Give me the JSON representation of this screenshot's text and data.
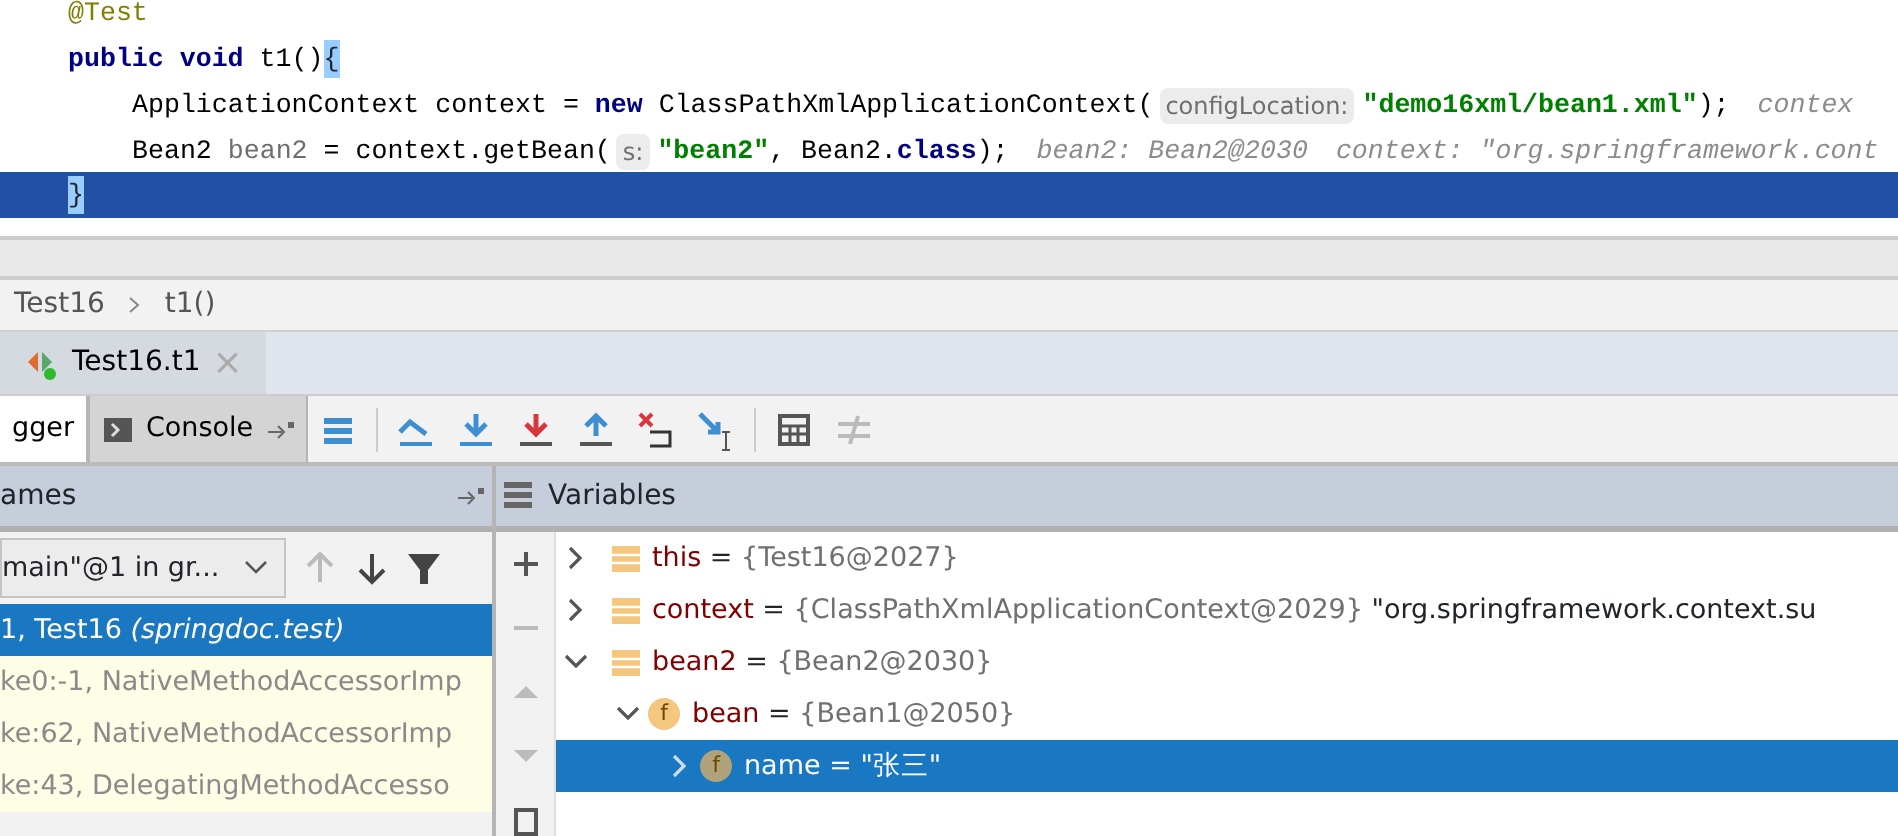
{
  "editor": {
    "lines": [
      {
        "current": false,
        "tokens": [
          {
            "kind": "annotation",
            "text": "@Test"
          }
        ]
      },
      {
        "current": false,
        "tokens": [
          {
            "kind": "keyword",
            "text": "public void"
          },
          {
            "kind": "plain",
            "text": " t1()"
          },
          {
            "kind": "brace",
            "text": "{"
          }
        ],
        "children": [
          {
            "current": false,
            "tokens": [
              {
                "kind": "plain",
                "text": "ApplicationContext context = "
              },
              {
                "kind": "keyword",
                "text": "new"
              },
              {
                "kind": "plain",
                "text": " ClassPathXmlApplicationContext("
              },
              {
                "kind": "param",
                "text": "configLocation:"
              },
              {
                "kind": "string",
                "text": "\"demo16xml/bean1.xml\""
              },
              {
                "kind": "plain",
                "text": ");"
              },
              {
                "kind": "hint",
                "text": "contex"
              }
            ]
          },
          {
            "current": false,
            "tokens": [
              {
                "kind": "plain",
                "text": "Bean2 "
              },
              {
                "kind": "local",
                "text": "bean2"
              },
              {
                "kind": "plain",
                "text": " = context.getBean("
              },
              {
                "kind": "param",
                "text": "s:"
              },
              {
                "kind": "string",
                "text": "\"bean2\""
              },
              {
                "kind": "plain",
                "text": ", Bean2."
              },
              {
                "kind": "keyword",
                "text": "class"
              },
              {
                "kind": "plain",
                "text": ");"
              },
              {
                "kind": "hint",
                "text": "bean2: Bean2@2030"
              },
              {
                "kind": "hint",
                "text": "context: \"org.springframework.cont"
              }
            ]
          }
        ]
      },
      {
        "current": true,
        "tokens": [
          {
            "kind": "brace",
            "text": "}"
          }
        ]
      }
    ]
  },
  "breadcrumb": [
    {
      "text": "Test16"
    },
    {
      "text": "t1()"
    }
  ],
  "run_tab": {
    "label": "Test16.t1",
    "close": "×"
  },
  "debug_tabs": [
    {
      "label": "gger",
      "selected": true
    },
    {
      "label": "Console",
      "selected": false
    }
  ],
  "frames": {
    "title": "ames",
    "thread": "main\"@1 in gr...",
    "rows": [
      {
        "text": "1, Test16",
        "package": "(springdoc.test)",
        "selected": true,
        "kind": "user"
      },
      {
        "text": "ke0:-1, NativeMethodAccessorImp",
        "selected": false,
        "kind": "library"
      },
      {
        "text": "ke:62, NativeMethodAccessorImp",
        "selected": false,
        "kind": "library"
      },
      {
        "text": "ke:43, DelegatingMethodAccesso",
        "selected": false,
        "kind": "library"
      }
    ]
  },
  "variables": {
    "title": "Variables",
    "items": [
      {
        "kind": "local",
        "name": "this",
        "assign": "=",
        "value": "{Test16@2027}",
        "expanded": false,
        "selected": false
      },
      {
        "kind": "local",
        "name": "context",
        "assign": "=",
        "value": "{ClassPathXmlApplicationContext@2029}",
        "extra": "\"org.springframework.context.su",
        "expanded": false,
        "selected": false
      },
      {
        "kind": "local",
        "name": "bean2",
        "assign": "=",
        "value": "{Bean2@2030}",
        "expanded": true,
        "selected": false,
        "children": [
          {
            "kind": "field",
            "letter": "f",
            "name": "bean",
            "assign": "=",
            "value": "{Bean1@2050}",
            "expanded": true,
            "selected": false,
            "children": [
              {
                "kind": "field",
                "letter": "f",
                "name": "name",
                "assign": "=",
                "value": "\"张三\"",
                "expanded": false,
                "selected": true
              }
            ]
          }
        ]
      }
    ]
  }
}
